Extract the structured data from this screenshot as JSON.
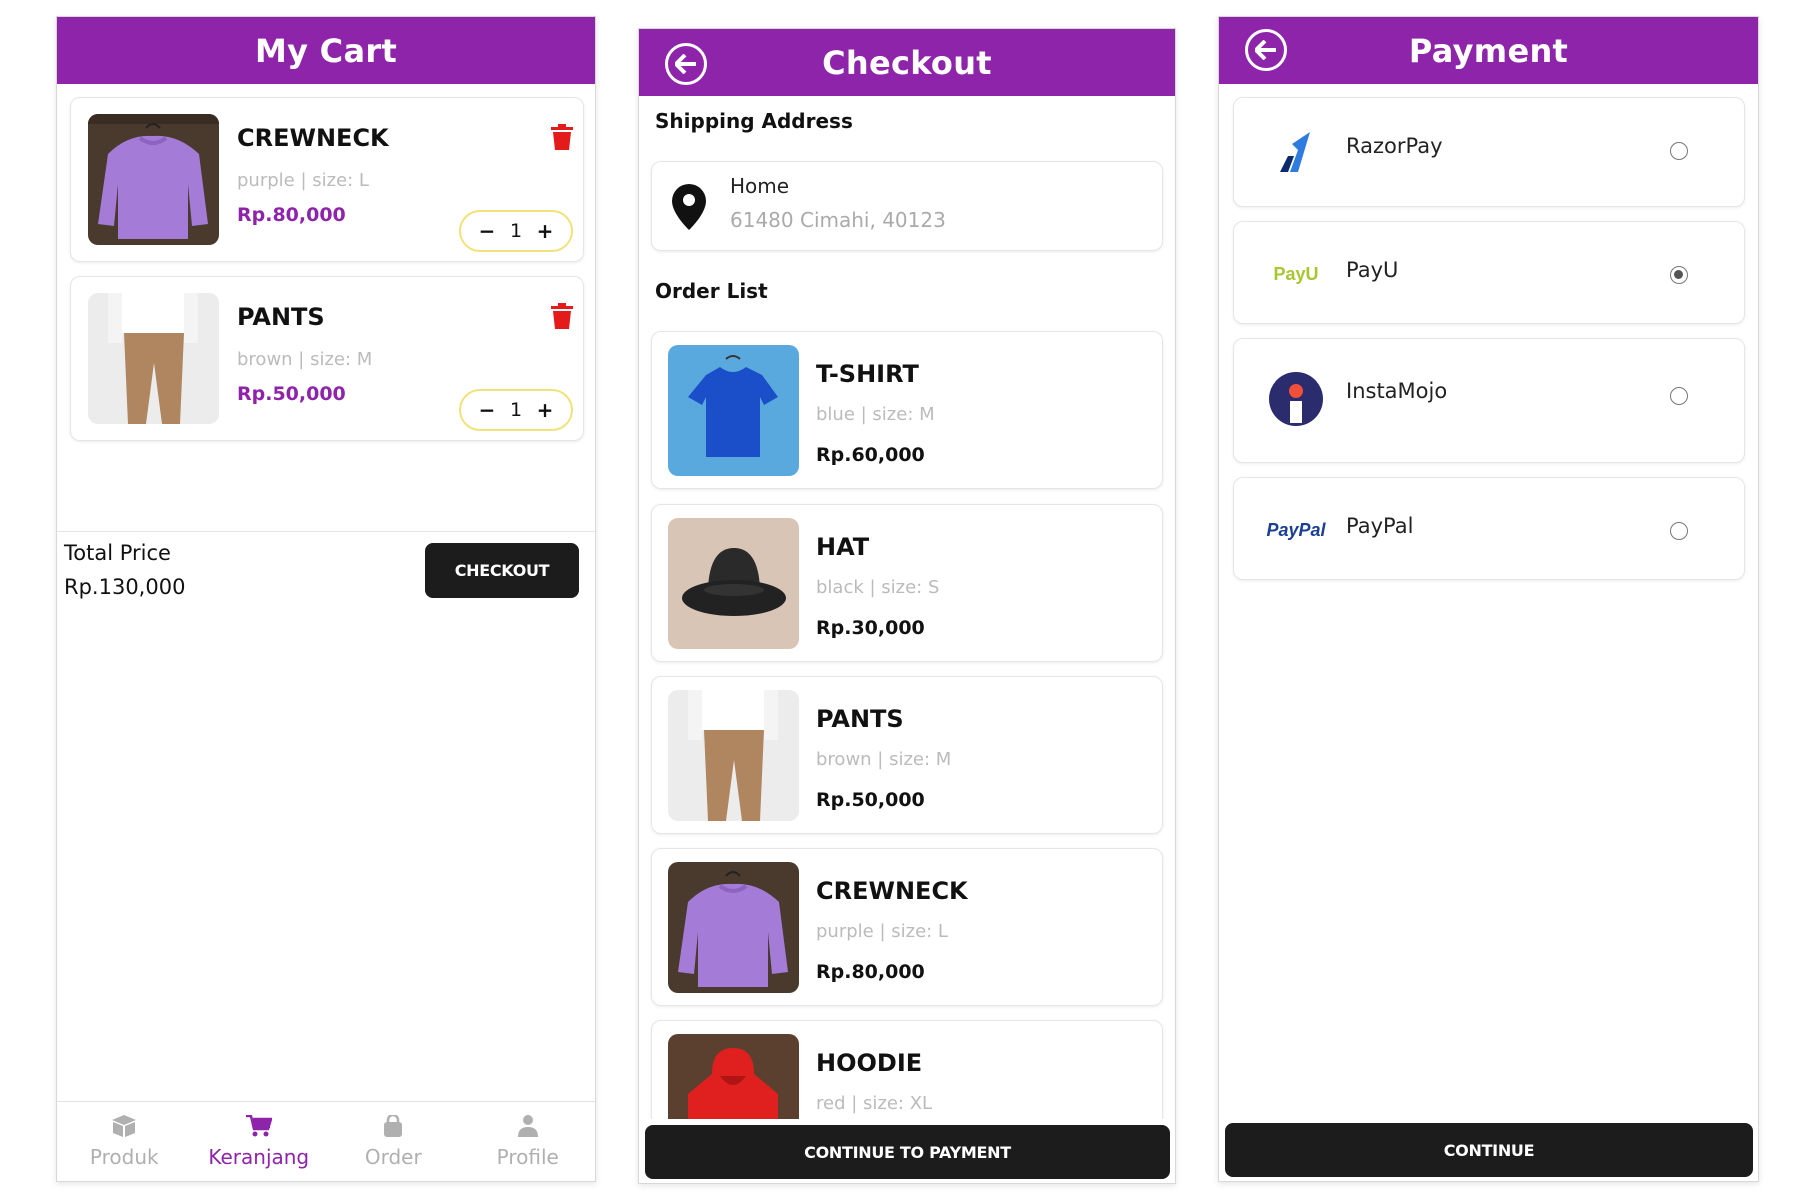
{
  "theme": {
    "accent": "#8e24aa",
    "price_cart": "#8e24aa",
    "price_order": "#111111",
    "dark": "#1c1c1c",
    "danger": "#e31b1b",
    "stepper_border": "#f2e27a"
  },
  "cart": {
    "title": "My Cart",
    "items": [
      {
        "name": "CREWNECK",
        "meta": "purple  |  size: L",
        "price": "Rp.80,000",
        "qty": "1",
        "image": "purple-sweater-image"
      },
      {
        "name": "PANTS",
        "meta": "brown  |  size: M",
        "price": "Rp.50,000",
        "qty": "1",
        "image": "brown-pants-image"
      }
    ],
    "minus": "−",
    "plus": "+",
    "total_label": "Total Price",
    "total_value": "Rp.130,000",
    "checkout_label": "CHECKOUT",
    "nav": [
      {
        "label": "Produk",
        "icon": "box-icon",
        "active": false
      },
      {
        "label": "Keranjang",
        "icon": "cart-icon",
        "active": true
      },
      {
        "label": "Order",
        "icon": "bag-icon",
        "active": false
      },
      {
        "label": "Profile",
        "icon": "user-icon",
        "active": false
      }
    ]
  },
  "checkout": {
    "title": "Checkout",
    "shipping_heading": "Shipping Address",
    "address_label": "Home",
    "address_line": "61480 Cimahi, 40123",
    "order_heading": "Order List",
    "items": [
      {
        "name": "T-SHIRT",
        "meta": "blue  |  size: M",
        "price": "Rp.60,000",
        "image": "blue-tshirt-image"
      },
      {
        "name": "HAT",
        "meta": "black  |  size: S",
        "price": "Rp.30,000",
        "image": "black-hat-image"
      },
      {
        "name": "PANTS",
        "meta": "brown  |  size: M",
        "price": "Rp.50,000",
        "image": "brown-pants-image"
      },
      {
        "name": "CREWNECK",
        "meta": "purple  |  size: L",
        "price": "Rp.80,000",
        "image": "purple-sweater-image"
      },
      {
        "name": "HOODIE",
        "meta": "red  |  size: XL",
        "price": "",
        "image": "red-hoodie-image"
      }
    ],
    "continue_label": "CONTINUE TO PAYMENT"
  },
  "payment": {
    "title": "Payment",
    "methods": [
      {
        "name": "RazorPay",
        "logo": "razorpay-logo",
        "selected": false
      },
      {
        "name": "PayU",
        "logo": "payu-logo",
        "logo_text": "PayU",
        "selected": true
      },
      {
        "name": "InstaMojo",
        "logo": "instamojo-logo",
        "selected": false
      },
      {
        "name": "PayPal",
        "logo": "paypal-logo",
        "logo_text": "PayPal",
        "selected": false
      }
    ],
    "continue_label": "CONTINUE"
  }
}
